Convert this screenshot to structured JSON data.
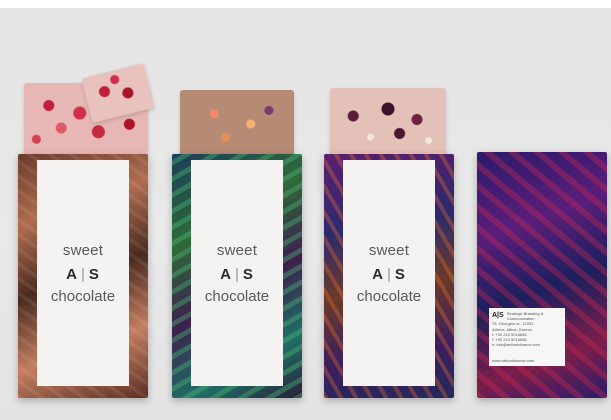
{
  "products": [
    {
      "id": 1,
      "chocolate": "strawberry-pieces",
      "label_line1": "sweet",
      "brand_left": "A",
      "brand_right": "S",
      "label_line3": "chocolate"
    },
    {
      "id": 2,
      "chocolate": "milk-fruit-pieces",
      "label_line1": "sweet",
      "brand_left": "A",
      "brand_right": "S",
      "label_line3": "chocolate"
    },
    {
      "id": 3,
      "chocolate": "berry-nut-pieces",
      "label_line1": "sweet",
      "brand_left": "A",
      "brand_right": "S",
      "label_line3": "chocolate"
    }
  ],
  "back": {
    "brand": "A|S",
    "company": "Strategic Branding & Communication",
    "address1": "75, Georgiou st., 11632",
    "address2": "Athens, Attica, Greece",
    "phone": "t: +30 210 9016636",
    "fax": "f: +30 210 9016636",
    "email": "e: info@arthurlobanov.com",
    "web": "www.arthurlobanov.com"
  },
  "colors": {
    "background": "#e6e6e6",
    "label": "#f4f3f1",
    "text": "#5a5a5a"
  }
}
